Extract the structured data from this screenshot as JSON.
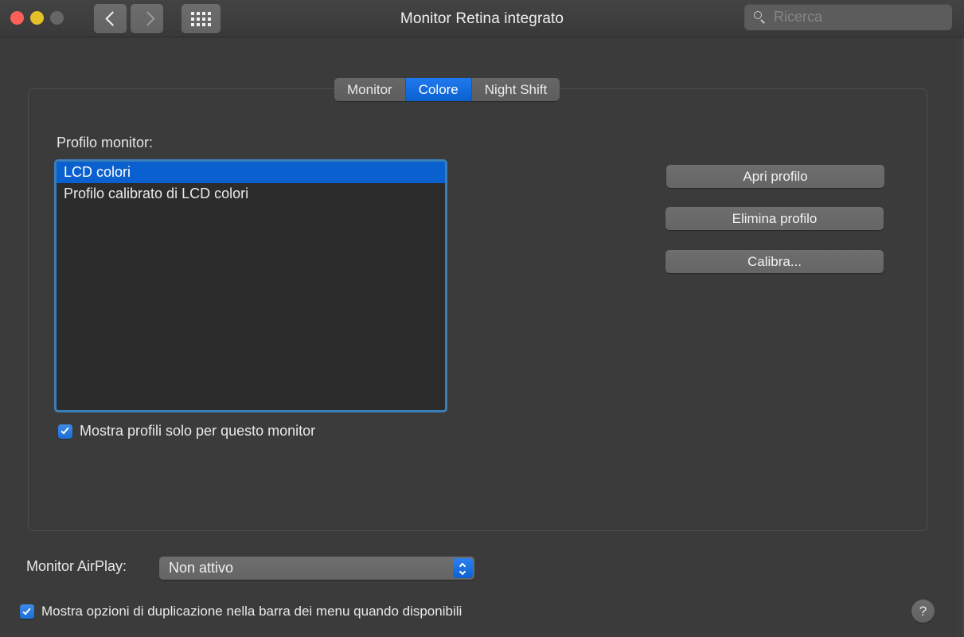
{
  "window": {
    "title": "Monitor Retina integrato",
    "traffic_lights": [
      {
        "name": "close",
        "color": "#fe5f57"
      },
      {
        "name": "minimize",
        "color": "#e6c029"
      },
      {
        "name": "zoom",
        "color": "#666666"
      }
    ],
    "nav": {
      "back_icon": "chevron-left-icon",
      "forward_icon": "chevron-right-icon",
      "grid_icon": "grid-apps-icon"
    },
    "search": {
      "icon": "search-icon",
      "placeholder": "Ricerca",
      "value": ""
    }
  },
  "tabs": [
    {
      "label": "Monitor",
      "active": false
    },
    {
      "label": "Colore",
      "active": true
    },
    {
      "label": "Night Shift",
      "active": false
    }
  ],
  "main": {
    "profile_label": "Profilo monitor:",
    "profile_list": [
      {
        "label": "LCD colori",
        "selected": true
      },
      {
        "label": "Profilo calibrato di LCD colori",
        "selected": false
      }
    ],
    "buttons": {
      "open_profile": "Apri profilo",
      "delete_profile": "Elimina profilo",
      "calibrate": "Calibra..."
    },
    "show_only_this_monitor": {
      "label": "Mostra profili solo per questo monitor",
      "checked": true
    }
  },
  "footer": {
    "airplay_label": "Monitor AirPlay:",
    "airplay_value": "Non attivo",
    "airplay_stepper_icon": "chevron-up-down-icon",
    "mirror_option": {
      "label": "Mostra opzioni di duplicazione nella barra dei menu quando disponibili",
      "checked": true
    },
    "help_label": "?"
  },
  "colors": {
    "accent_blue": "#0a60ce",
    "focus_ring": "#3a7fb8",
    "window_bg": "#3b3b3b",
    "list_bg": "#2c2c2c"
  }
}
